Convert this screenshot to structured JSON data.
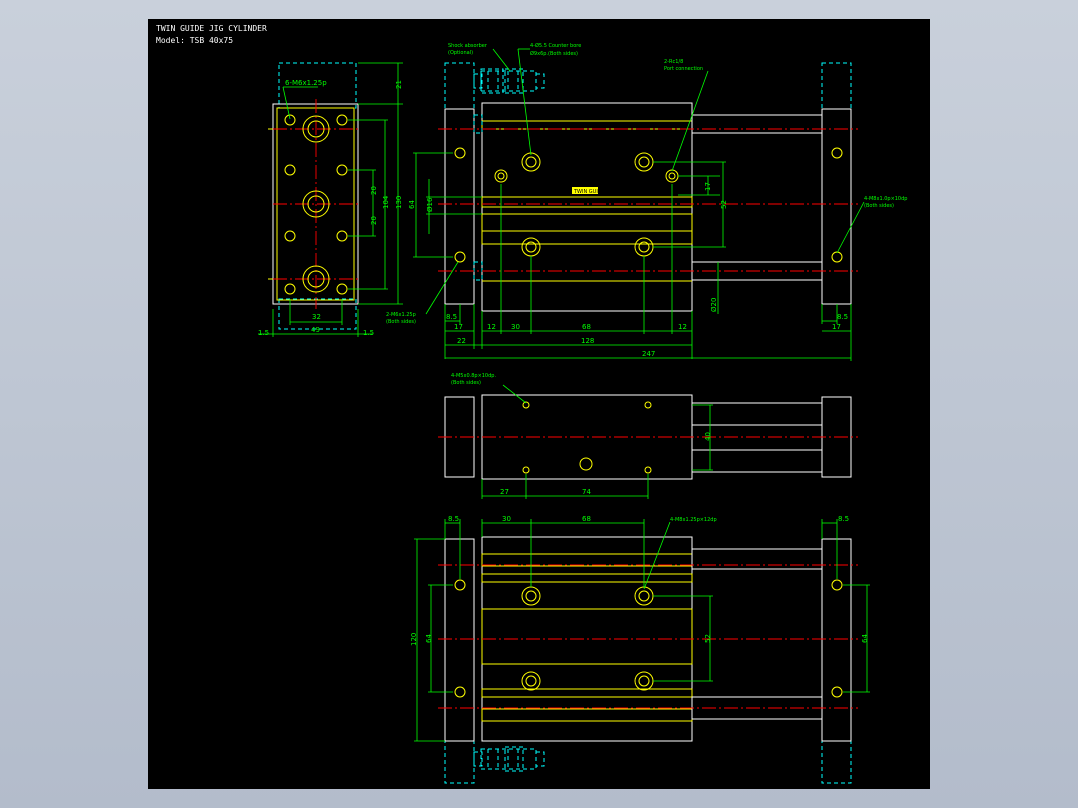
{
  "drawing": {
    "title_line1": "TWIN GUIDE JIG CYLINDER",
    "title_line2": "Model: TSB 40x75"
  },
  "colors": {
    "screen_background": "#b3bccb",
    "canvas": "#000000",
    "outline": "#ffffff",
    "part_edge": "#ffff00",
    "dimension": "#00ff00",
    "hidden": "#00ffff",
    "centerline": "#ff0000"
  },
  "labels": {
    "end_tapped": "6-M6x1.25p",
    "shock_absorber": "Shock absorber",
    "optional": "(Optional)",
    "counter_bore": "4-Ø5.5 Counter bore",
    "counter_bore_sub": "Ø9x6p.(Both sides)",
    "port": "2-Rc1/8",
    "port_sub": "Port connection",
    "side_tapped": "4-M8x1.0p×10dp",
    "both_sides": "(Both sides)",
    "front_tapped": "2-M6x1.25p",
    "front_tapped_sub": "(Both sides)",
    "top_tapped": "4-M5x0.8p×10dp.",
    "top_tapped_sub": "(Both sides)",
    "bottom_tapped": "4-M8x1.25p×12dp",
    "nameplate": "TWIN GUIDE"
  },
  "dims": {
    "end": {
      "d21": "21",
      "d130": "130",
      "d104": "104",
      "d20a": "20",
      "d20b": "20",
      "d32": "32",
      "d49": "49",
      "d15a": "1.5",
      "d15b": "1.5"
    },
    "front": {
      "d64": "64",
      "d16": "Ø16",
      "d17v": "17",
      "d52": "52",
      "d20": "Ø20",
      "d85a": "8.5",
      "d85b": "8.5",
      "d12a": "12",
      "d30": "30",
      "d68": "68",
      "d12b": "12",
      "d17a": "17",
      "d17b": "17",
      "d22": "22",
      "d128": "128",
      "d247": "247"
    },
    "top": {
      "d40": "40",
      "d27": "27",
      "d74": "74"
    },
    "bottom": {
      "d85a": "8.5",
      "d30": "30",
      "d68": "68",
      "d85b": "8.5",
      "d120": "120",
      "d64a": "64",
      "d52": "52",
      "d64b": "64"
    }
  }
}
